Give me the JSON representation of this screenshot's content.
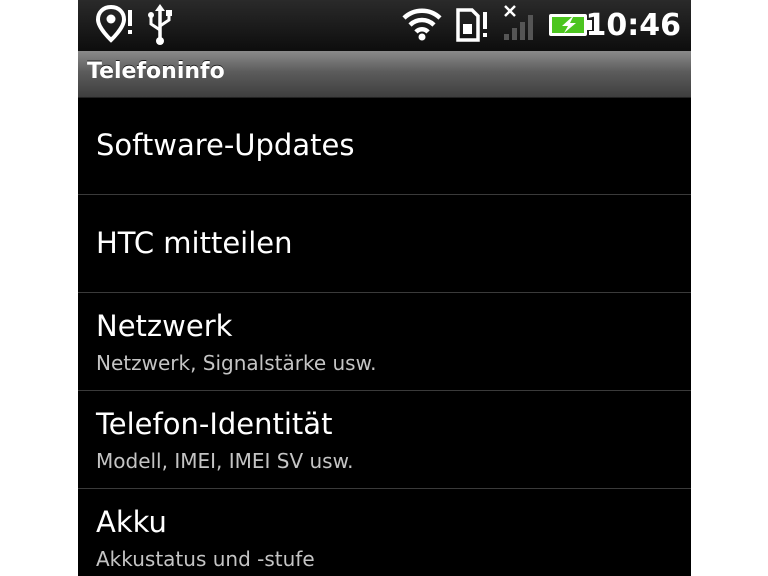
{
  "status_bar": {
    "icons": [
      "location-alert-icon",
      "usb-icon",
      "wifi-icon",
      "sim-alert-icon",
      "no-signal-icon",
      "battery-charging-icon"
    ],
    "time": "10:46",
    "colors": {
      "battery": "#4cc51f",
      "icons": "#ffffff"
    }
  },
  "header": {
    "title": "Telefoninfo"
  },
  "list": {
    "items": [
      {
        "label": "Software-Updates",
        "sub": ""
      },
      {
        "label": "HTC mitteilen",
        "sub": ""
      },
      {
        "label": "Netzwerk",
        "sub": "Netzwerk, Signalstärke usw."
      },
      {
        "label": "Telefon-Identität",
        "sub": "Modell, IMEI, IMEI SV usw."
      },
      {
        "label": "Akku",
        "sub": "Akkustatus und -stufe"
      }
    ]
  }
}
